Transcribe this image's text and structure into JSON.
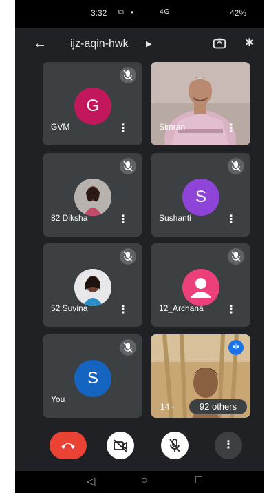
{
  "status_bar": {
    "time": "3:32",
    "network": "4G",
    "battery": "42%"
  },
  "header": {
    "meeting_code": "ijz-aqin-hwk"
  },
  "participants": [
    {
      "name": "GVM",
      "initial": "G",
      "avatar_color": "#c2185b",
      "muted": true
    },
    {
      "name": "Simran",
      "initial": "",
      "muted": false
    },
    {
      "name": "82 Diksha",
      "initial": "",
      "muted": true
    },
    {
      "name": "Sushanti",
      "initial": "S",
      "avatar_color": "#8e44d6",
      "muted": true
    },
    {
      "name": "52 Suvina",
      "initial": "",
      "muted": true
    },
    {
      "name": "12_Archana",
      "initial": "",
      "avatar_color": "#ec407a",
      "muted": true
    },
    {
      "name": "You",
      "initial": "S",
      "avatar_color": "#1565c0",
      "muted": true
    },
    {
      "name": "14 -",
      "others_label": "92 others",
      "muted": false
    }
  ],
  "controls": {
    "end_call": "end-call",
    "camera": "camera-off",
    "mic": "mic-off",
    "more": "more-options"
  },
  "colors": {
    "background": "#202124",
    "tile": "#3c4043",
    "end_call": "#ea4335",
    "active_speaker": "#1a73e8"
  }
}
